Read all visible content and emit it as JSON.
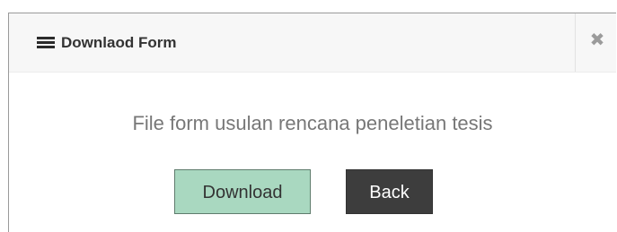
{
  "dialog": {
    "title": "Downlaod Form",
    "menu_icon": "hamburger-menu-icon",
    "close_icon": "close-icon",
    "close_glyph": "✖"
  },
  "content": {
    "message": "File form usulan rencana peneletian tesis"
  },
  "buttons": {
    "download_label": "Download",
    "back_label": "Back"
  },
  "colors": {
    "download_bg": "#a9d8c0",
    "back_bg": "#3d3d3d",
    "header_bg": "#f7f7f7",
    "message_text": "#777777"
  }
}
